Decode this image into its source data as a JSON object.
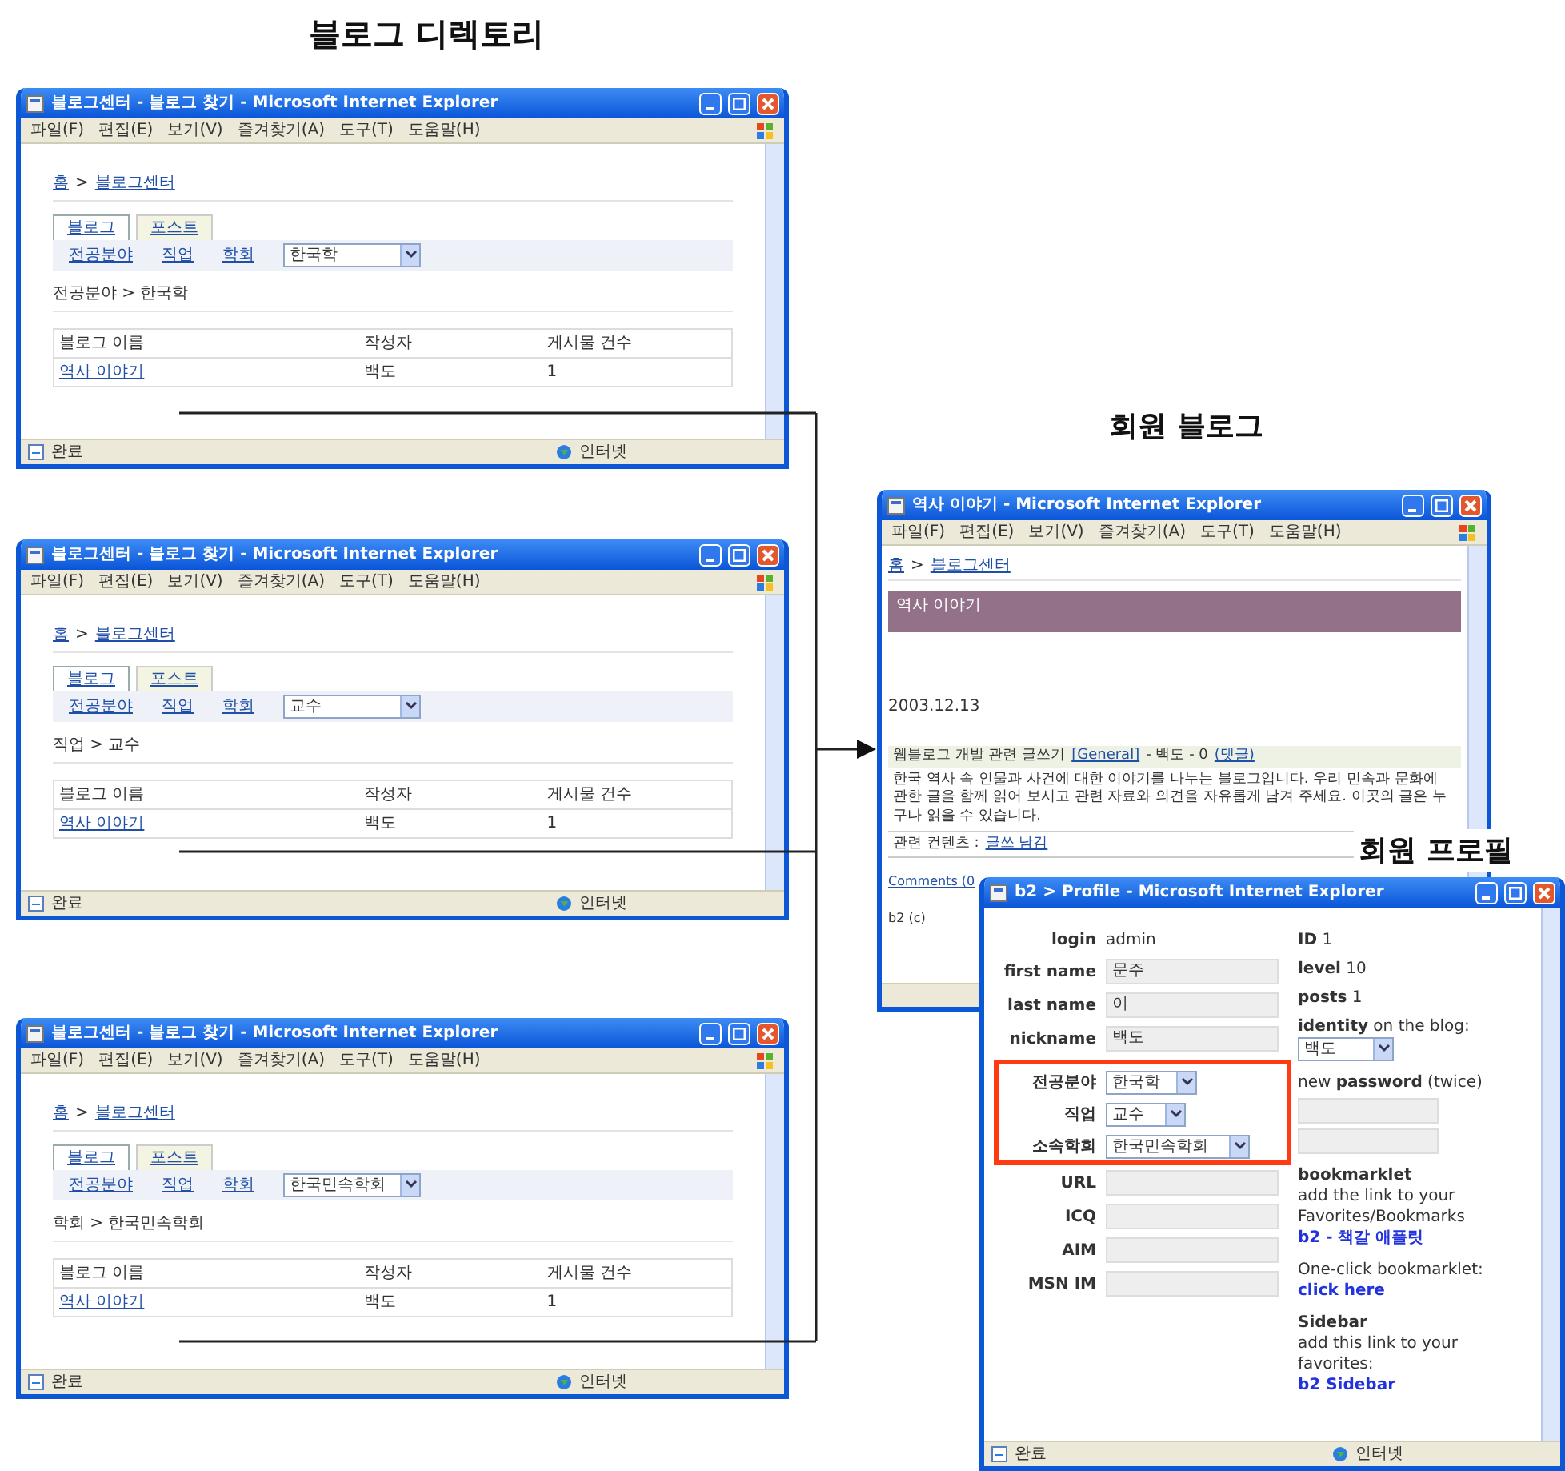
{
  "captions": [
    {
      "text": "블로그 디렉토리"
    },
    {
      "text": "회원 블로그"
    },
    {
      "text": "회원 프로필"
    }
  ],
  "directory_windows": [
    {
      "title": "블로그센터 - 블로그 찾기 - Microsoft Internet Explorer",
      "menu": [
        "파일(F)",
        "편집(E)",
        "보기(V)",
        "즐겨찾기(A)",
        "도구(T)",
        "도움말(H)"
      ],
      "breadcrumb": {
        "items": [
          "홈",
          "블로그센터"
        ],
        "separator": ">"
      },
      "tabs": [
        {
          "label": "블로그",
          "selected": true
        },
        {
          "label": "포스트",
          "selected": false
        }
      ],
      "filters": [
        "전공분야",
        "직업",
        "학회"
      ],
      "select_value": "한국학",
      "section_path": "전공분야 > 한국학",
      "table": {
        "columns": [
          "블로그 이름",
          "작성자",
          "게시물 건수"
        ],
        "rows": [
          [
            "역사 이야기",
            "백도",
            "1"
          ]
        ]
      },
      "status": {
        "left": "완료",
        "right": "인터넷"
      }
    },
    {
      "title": "블로그센터 - 블로그 찾기 - Microsoft Internet Explorer",
      "menu": [
        "파일(F)",
        "편집(E)",
        "보기(V)",
        "즐겨찾기(A)",
        "도구(T)",
        "도움말(H)"
      ],
      "breadcrumb": {
        "items": [
          "홈",
          "블로그센터"
        ],
        "separator": ">"
      },
      "tabs": [
        {
          "label": "블로그",
          "selected": true
        },
        {
          "label": "포스트",
          "selected": false
        }
      ],
      "filters": [
        "전공분야",
        "직업",
        "학회"
      ],
      "select_value": "교수",
      "section_path": "직업 > 교수",
      "table": {
        "columns": [
          "블로그 이름",
          "작성자",
          "게시물 건수"
        ],
        "rows": [
          [
            "역사 이야기",
            "백도",
            "1"
          ]
        ]
      },
      "status": {
        "left": "완료",
        "right": "인터넷"
      }
    },
    {
      "title": "블로그센터 - 블로그 찾기 - Microsoft Internet Explorer",
      "menu": [
        "파일(F)",
        "편집(E)",
        "보기(V)",
        "즐겨찾기(A)",
        "도구(T)",
        "도움말(H)"
      ],
      "breadcrumb": {
        "items": [
          "홈",
          "블로그센터"
        ],
        "separator": ">"
      },
      "tabs": [
        {
          "label": "블로그",
          "selected": true
        },
        {
          "label": "포스트",
          "selected": false
        }
      ],
      "filters": [
        "전공분야",
        "직업",
        "학회"
      ],
      "select_value": "한국민속학회",
      "section_path": "학회 > 한국민속학회",
      "table": {
        "columns": [
          "블로그 이름",
          "작성자",
          "게시물 건수"
        ],
        "rows": [
          [
            "역사 이야기",
            "백도",
            "1"
          ]
        ]
      },
      "status": {
        "left": "완료",
        "right": "인터넷"
      }
    }
  ],
  "blog_window": {
    "title": "역사 이야기 - Microsoft Internet Explorer",
    "menu": [
      "파일(F)",
      "편집(E)",
      "보기(V)",
      "즐겨찾기(A)",
      "도구(T)",
      "도움말(H)"
    ],
    "breadcrumb": {
      "items": [
        "홈",
        "블로그센터"
      ],
      "separator": ">"
    },
    "blog_title": "역사 이야기",
    "date": "2003.12.13",
    "post_meta": [
      {
        "text": "웹블로그 개발 관련 글쓰기",
        "link": false
      },
      {
        "text": "[General]",
        "link": true
      },
      {
        "text": "- 백도 - 0",
        "link": false
      },
      {
        "text": "(댓글)",
        "link": true
      }
    ],
    "post_body": "한국 역사 속 인물과 사건에 대한 이야기를 나누는 블로그입니다. 우리 민속과 문화에 관한 글을 함께 읽어 보시고 관련 자료와 의견을 자유롭게 남겨 주세요. 이곳의 글은 누구나 읽을 수 있습니다.",
    "related": [
      {
        "text": "관련 컨텐츠 :",
        "link": false
      },
      {
        "text": "글쓰 남김",
        "link": true
      }
    ],
    "comments_link": "Comments (0",
    "footer": "b2 (c)"
  },
  "profile_window": {
    "title": "b2 > Profile - Microsoft Internet Explorer",
    "fields": [
      {
        "kind": "static",
        "label": "login",
        "value": "admin",
        "highlighted": false
      },
      {
        "kind": "text",
        "label": "first name",
        "value": "문주",
        "highlighted": false
      },
      {
        "kind": "text",
        "label": "last name",
        "value": "이",
        "highlighted": false
      },
      {
        "kind": "text",
        "label": "nickname",
        "value": "백도",
        "highlighted": false
      },
      {
        "kind": "select",
        "label": "전공분야",
        "value": "한국학",
        "highlighted": true
      },
      {
        "kind": "select",
        "label": "직업",
        "value": "교수",
        "highlighted": true
      },
      {
        "kind": "select",
        "label": "소속학회",
        "value": "한국민속학회",
        "highlighted": true
      },
      {
        "kind": "text",
        "label": "URL",
        "highlighted": false
      },
      {
        "kind": "text",
        "label": "ICQ",
        "highlighted": false
      },
      {
        "kind": "text",
        "label": "AIM",
        "highlighted": false
      },
      {
        "kind": "text",
        "label": "MSN IM",
        "highlighted": false
      }
    ],
    "side": [
      {
        "kind": "stat",
        "label": "ID",
        "value": "1"
      },
      {
        "kind": "stat",
        "label": "level",
        "value": "10"
      },
      {
        "kind": "stat",
        "label": "posts",
        "value": "1"
      },
      {
        "kind": "select",
        "text": "**identity** on the blog:",
        "value": "백도"
      },
      {
        "kind": "password",
        "text": "new **password** (twice)"
      },
      {
        "kind": "link",
        "title": "bookmarklet",
        "text": "add the link to your Favorites/Bookmarks",
        "link": "b2 - 책갈 애플릿"
      },
      {
        "kind": "link",
        "text": "One-click bookmarklet:",
        "link": "click here"
      },
      {
        "kind": "link",
        "title": "Sidebar",
        "text": "add this link to your favorites:",
        "link": "b2 Sidebar"
      }
    ],
    "status": {
      "left": "완료",
      "right": "인터넷"
    }
  }
}
